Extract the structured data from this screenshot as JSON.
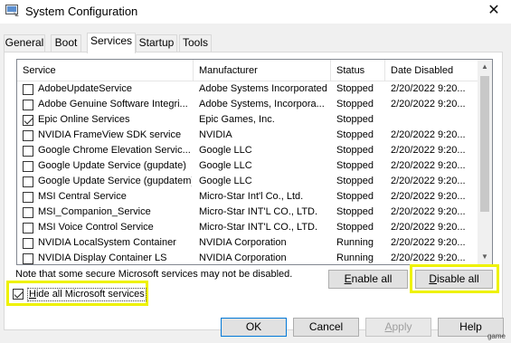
{
  "window": {
    "title": "System Configuration",
    "close_glyph": "✕"
  },
  "tabs": [
    {
      "label": "General"
    },
    {
      "label": "Boot"
    },
    {
      "label": "Services"
    },
    {
      "label": "Startup"
    },
    {
      "label": "Tools"
    }
  ],
  "active_tab": "Services",
  "list": {
    "columns": [
      "Service",
      "Manufacturer",
      "Status",
      "Date Disabled"
    ],
    "rows": [
      {
        "checked": false,
        "service": "AdobeUpdateService",
        "manufacturer": "Adobe Systems Incorporated",
        "status": "Stopped",
        "date": "2/20/2022 9:20..."
      },
      {
        "checked": false,
        "service": "Adobe Genuine Software Integri...",
        "manufacturer": "Adobe Systems, Incorpora...",
        "status": "Stopped",
        "date": "2/20/2022 9:20..."
      },
      {
        "checked": true,
        "service": "Epic Online Services",
        "manufacturer": "Epic Games, Inc.",
        "status": "Stopped",
        "date": ""
      },
      {
        "checked": false,
        "service": "NVIDIA FrameView SDK service",
        "manufacturer": "NVIDIA",
        "status": "Stopped",
        "date": "2/20/2022 9:20..."
      },
      {
        "checked": false,
        "service": "Google Chrome Elevation Servic...",
        "manufacturer": "Google LLC",
        "status": "Stopped",
        "date": "2/20/2022 9:20..."
      },
      {
        "checked": false,
        "service": "Google Update Service (gupdate)",
        "manufacturer": "Google LLC",
        "status": "Stopped",
        "date": "2/20/2022 9:20..."
      },
      {
        "checked": false,
        "service": "Google Update Service (gupdatem)",
        "manufacturer": "Google LLC",
        "status": "Stopped",
        "date": "2/20/2022 9:20..."
      },
      {
        "checked": false,
        "service": "MSI Central Service",
        "manufacturer": "Micro-Star Int'l Co., Ltd.",
        "status": "Stopped",
        "date": "2/20/2022 9:20..."
      },
      {
        "checked": false,
        "service": "MSI_Companion_Service",
        "manufacturer": "Micro-Star INT'L CO., LTD.",
        "status": "Stopped",
        "date": "2/20/2022 9:20..."
      },
      {
        "checked": false,
        "service": "MSI Voice Control Service",
        "manufacturer": "Micro-Star INT'L CO., LTD.",
        "status": "Stopped",
        "date": "2/20/2022 9:20..."
      },
      {
        "checked": false,
        "service": "NVIDIA LocalSystem Container",
        "manufacturer": "NVIDIA Corporation",
        "status": "Running",
        "date": "2/20/2022 9:20..."
      },
      {
        "checked": false,
        "service": "NVIDIA Display Container LS",
        "manufacturer": "NVIDIA Corporation",
        "status": "Running",
        "date": "2/20/2022 9:20..."
      }
    ]
  },
  "note": "Note that some secure Microsoft services may not be disabled.",
  "buttons": {
    "enable_all": {
      "pre": "",
      "accel": "E",
      "post": "nable all"
    },
    "disable_all": {
      "pre": "",
      "accel": "D",
      "post": "isable all"
    },
    "ok": "OK",
    "cancel": "Cancel",
    "apply": {
      "pre": "",
      "accel": "A",
      "post": "pply"
    },
    "help": "Help"
  },
  "hide_ms": {
    "checked": true,
    "pre": "",
    "accel": "H",
    "post": "ide all Microsoft services"
  },
  "highlight_color": "#eef200",
  "watermark": "game"
}
